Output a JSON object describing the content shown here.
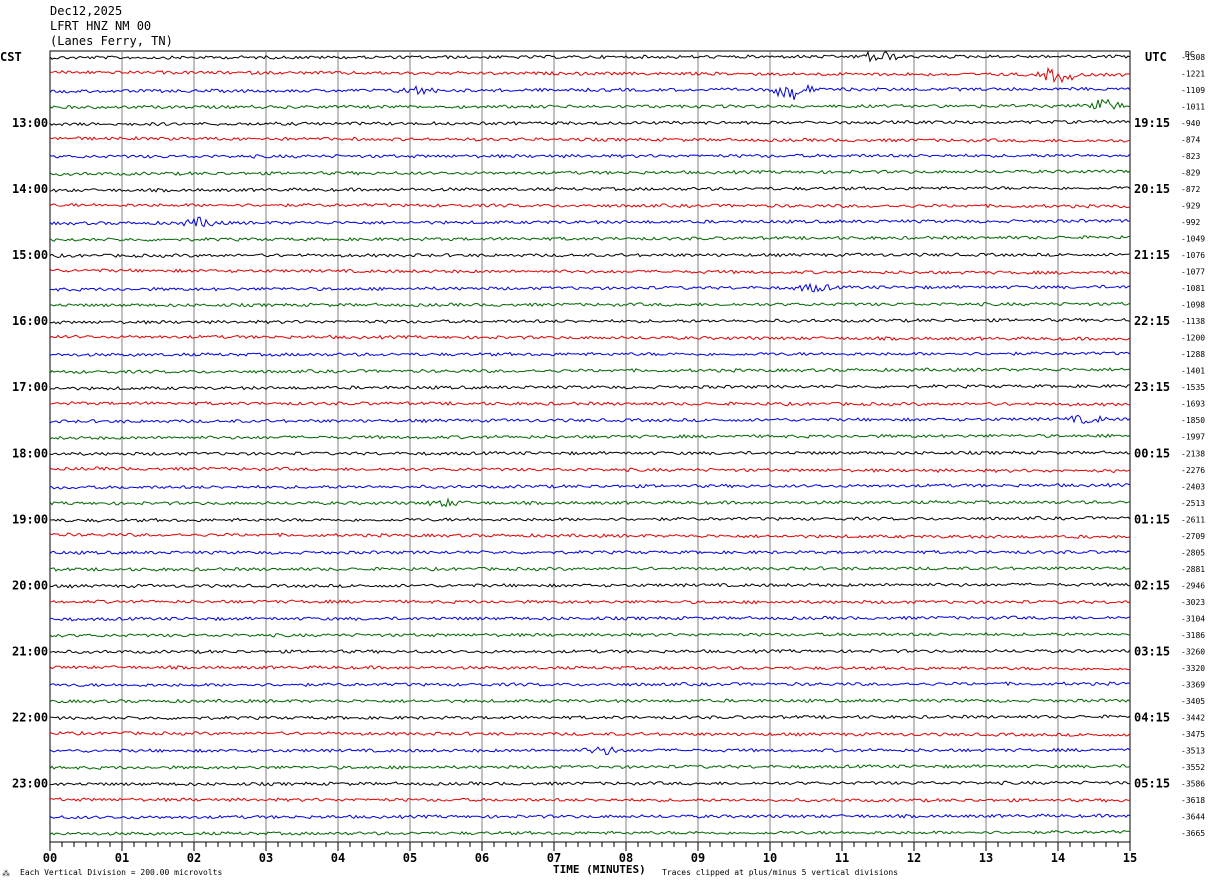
{
  "header": {
    "date": "Dec12,2025",
    "station": "LFRT HNZ NM 00",
    "location": "(Lanes Ferry, TN)"
  },
  "left_tz": "CST",
  "right_tz": "UTC",
  "dc_label": "DC",
  "footer": {
    "left_mark": "⁂",
    "scale": "Each Vertical Division =  200.00 microvolts",
    "xlabel": "TIME (MINUTES)",
    "clip": "Traces clipped at plus/minus 5 vertical divisions"
  },
  "colors": {
    "trace_cycle": [
      "#000000",
      "#e00000",
      "#0000e0",
      "#006600"
    ],
    "grid": "#808080"
  },
  "chart_data": {
    "type": "line",
    "title": "",
    "xlabel": "TIME (MINUTES)",
    "ylabel": "",
    "xlim": [
      0,
      15
    ],
    "x_ticks": [
      "00",
      "01",
      "02",
      "03",
      "04",
      "05",
      "06",
      "07",
      "08",
      "09",
      "10",
      "11",
      "12",
      "13",
      "14",
      "15"
    ],
    "left_time_labels": [
      "13:00",
      "14:00",
      "15:00",
      "16:00",
      "17:00",
      "18:00",
      "19:00",
      "20:00",
      "21:00",
      "22:00",
      "23:00"
    ],
    "right_time_labels": [
      "19:15",
      "20:15",
      "21:15",
      "22:15",
      "23:15",
      "00:15",
      "01:15",
      "02:15",
      "03:15",
      "04:15",
      "05:15"
    ],
    "trace_count": 48,
    "dc_offsets": [
      "-1308",
      "-1221",
      "-1109",
      "-1011",
      "-940",
      "-874",
      "-823",
      "-829",
      "-872",
      "-929",
      "-992",
      "-1049",
      "-1076",
      "-1077",
      "-1081",
      "-1098",
      "-1138",
      "-1200",
      "-1288",
      "-1401",
      "-1535",
      "-1693",
      "-1850",
      "-1997",
      "-2138",
      "-2276",
      "-2403",
      "-2513",
      "-2611",
      "-2709",
      "-2805",
      "-2881",
      "-2946",
      "-3023",
      "-3104",
      "-3186",
      "-3260",
      "-3320",
      "-3369",
      "-3405",
      "-3442",
      "-3475",
      "-3513",
      "-3552",
      "-3586",
      "-3618",
      "-3644",
      "-3665"
    ],
    "events": [
      {
        "trace": 2,
        "minute": 10.3,
        "amplitude": 1.0
      },
      {
        "trace": 2,
        "minute": 5.1,
        "amplitude": 0.35
      },
      {
        "trace": 3,
        "minute": 14.6,
        "amplitude": 0.7
      },
      {
        "trace": 1,
        "minute": 14.0,
        "amplitude": 0.8
      },
      {
        "trace": 0,
        "minute": 11.5,
        "amplitude": 0.6
      },
      {
        "trace": 10,
        "minute": 2.1,
        "amplitude": 0.45
      },
      {
        "trace": 14,
        "minute": 10.6,
        "amplitude": 0.35
      },
      {
        "trace": 22,
        "minute": 14.4,
        "amplitude": 0.35
      },
      {
        "trace": 42,
        "minute": 7.7,
        "amplitude": 0.35
      },
      {
        "trace": 27,
        "minute": 5.5,
        "amplitude": 0.3
      }
    ]
  }
}
